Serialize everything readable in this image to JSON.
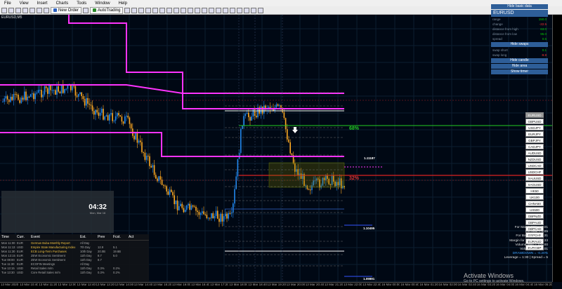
{
  "menu": [
    "File",
    "View",
    "Insert",
    "Charts",
    "Tools",
    "Window",
    "Help"
  ],
  "toolbar": {
    "new_order": "New Order",
    "autotrading": "AutoTrading"
  },
  "chart": {
    "symbol_title": "EURUSD,M5"
  },
  "panel": {
    "hide_button": "Hide basic data",
    "pair": "EURUSD",
    "rows": [
      {
        "label": "range",
        "value": "150.0"
      },
      {
        "label": "change",
        "value": "-22.5"
      },
      {
        "label": "distance from high",
        "value": "63.0"
      },
      {
        "label": "distance from low",
        "value": "95.0"
      },
      {
        "label": "spread",
        "value": "0.5"
      }
    ],
    "hide_swaps": "Hide swaps",
    "swaps": [
      {
        "label": "swap short",
        "value": "0.1"
      },
      {
        "label": "swap long",
        "value": "-9.8"
      }
    ],
    "buttons": [
      "Hide candle",
      "Hide area",
      "Show timer"
    ]
  },
  "symbols": [
    "EURUSD",
    "GBPUSD",
    "USDJPY",
    "EURJPY",
    "GBPJPY",
    "CADJPY",
    "AUDUSD",
    "NZDUSD",
    "USDCAD",
    "USDCHF",
    "XAUUSD",
    "XAGUSD",
    "HK50",
    "UK100",
    "CHNA50",
    "US500",
    "GBPNZD",
    "GBPAUD",
    "GBPCAD",
    "GBPCHF",
    "EURAUD",
    "EURGBP"
  ],
  "levels": {
    "pct_68": "68%",
    "pct_32": "32%",
    "price_right": "1.11187",
    "price_low": "1.10495",
    "price_bottom": "1.09891"
  },
  "account": {
    "lines": [
      "For Max 1.00% = 0.01",
      "Lot Max = 0.05",
      "For Balance = 211.31",
      "Margin for 1 lot = 3333.33",
      "Volume Max = 100.00",
      "Volume Min = 0.01"
    ],
    "drawdown": "DRAWDOWN = -0.20%",
    "leverage": "Leverage = 1:30 | Spread = 5"
  },
  "calendar": {
    "headers": [
      "Time",
      "Curr.",
      "Event",
      "Est.",
      "Prev",
      "Fcst.",
      "Act"
    ],
    "rows": [
      [
        "Mon 11:00",
        "EUR",
        "German Buba Monthly Report",
        "All Day",
        "",
        "",
        ""
      ],
      [
        "Mon 11:13",
        "USD",
        "Empire State Manufacturing Index",
        "7th Day",
        "12.9",
        "5.1",
        ""
      ],
      [
        "Mon 11:30",
        "EUR",
        "ECB Long-Term Purchases",
        "10th Day",
        "20.0B",
        "19.6B",
        ""
      ],
      [
        "Mon 13:15",
        "EUR",
        "ZEW Economic Sentiment",
        "11th Day",
        "8.7",
        "5.0",
        ""
      ],
      [
        "Tue 08:00",
        "EUR",
        "ZEW Economic Sentiment",
        "11th Day",
        "8.7",
        "",
        ""
      ],
      [
        "Tue 11:30",
        "EUR",
        "ECOFIN Meetings",
        "All Day",
        "",
        "",
        ""
      ],
      [
        "Tue 13:15",
        "USD",
        "Retail Sales m/m",
        "11th Day",
        "0.3%",
        "0.2%",
        ""
      ],
      [
        "Tue 13:30",
        "USD",
        "Core Retail Sales m/m",
        "11th Day",
        "0.3%",
        "0.2%",
        ""
      ]
    ]
  },
  "clock": {
    "time": "04:32",
    "date": "Mon, Mar 16"
  },
  "xaxis": [
    "13 Mar 2020",
    "13 Mar 10:40",
    "13 Mar 11:20",
    "13 Mar 12:00",
    "13 Mar 12:40",
    "13 Mar 13:20",
    "13 Mar 14:00",
    "13 Mar 14:40",
    "13 Mar 15:20",
    "13 Mar 16:00",
    "13 Mar 16:40",
    "13 Mar 17:20",
    "13 Mar 18:00",
    "13 Mar 18:40",
    "13 Mar 19:20",
    "13 Mar 20:00",
    "13 Mar 20:40",
    "13 Mar 21:20",
    "13 Mar 22:00",
    "13 Mar 22:40",
    "16 Mar 00:00",
    "16 Mar 00:40",
    "16 Mar 01:20",
    "16 Mar 02:00",
    "16 Mar 02:40",
    "16 Mar 03:20",
    "16 Mar 04:00",
    "16 Mar 04:40",
    "16 Mar 05:20"
  ],
  "activate": {
    "title": "Activate Windows",
    "sub": "Go to PC settings to activate Windows."
  },
  "colors": {
    "magenta": "#ff33ff",
    "candle_up": "#2288ee",
    "candle_down": "#ffaa22",
    "green_line": "#22cc22",
    "red_line": "#dd2222"
  }
}
